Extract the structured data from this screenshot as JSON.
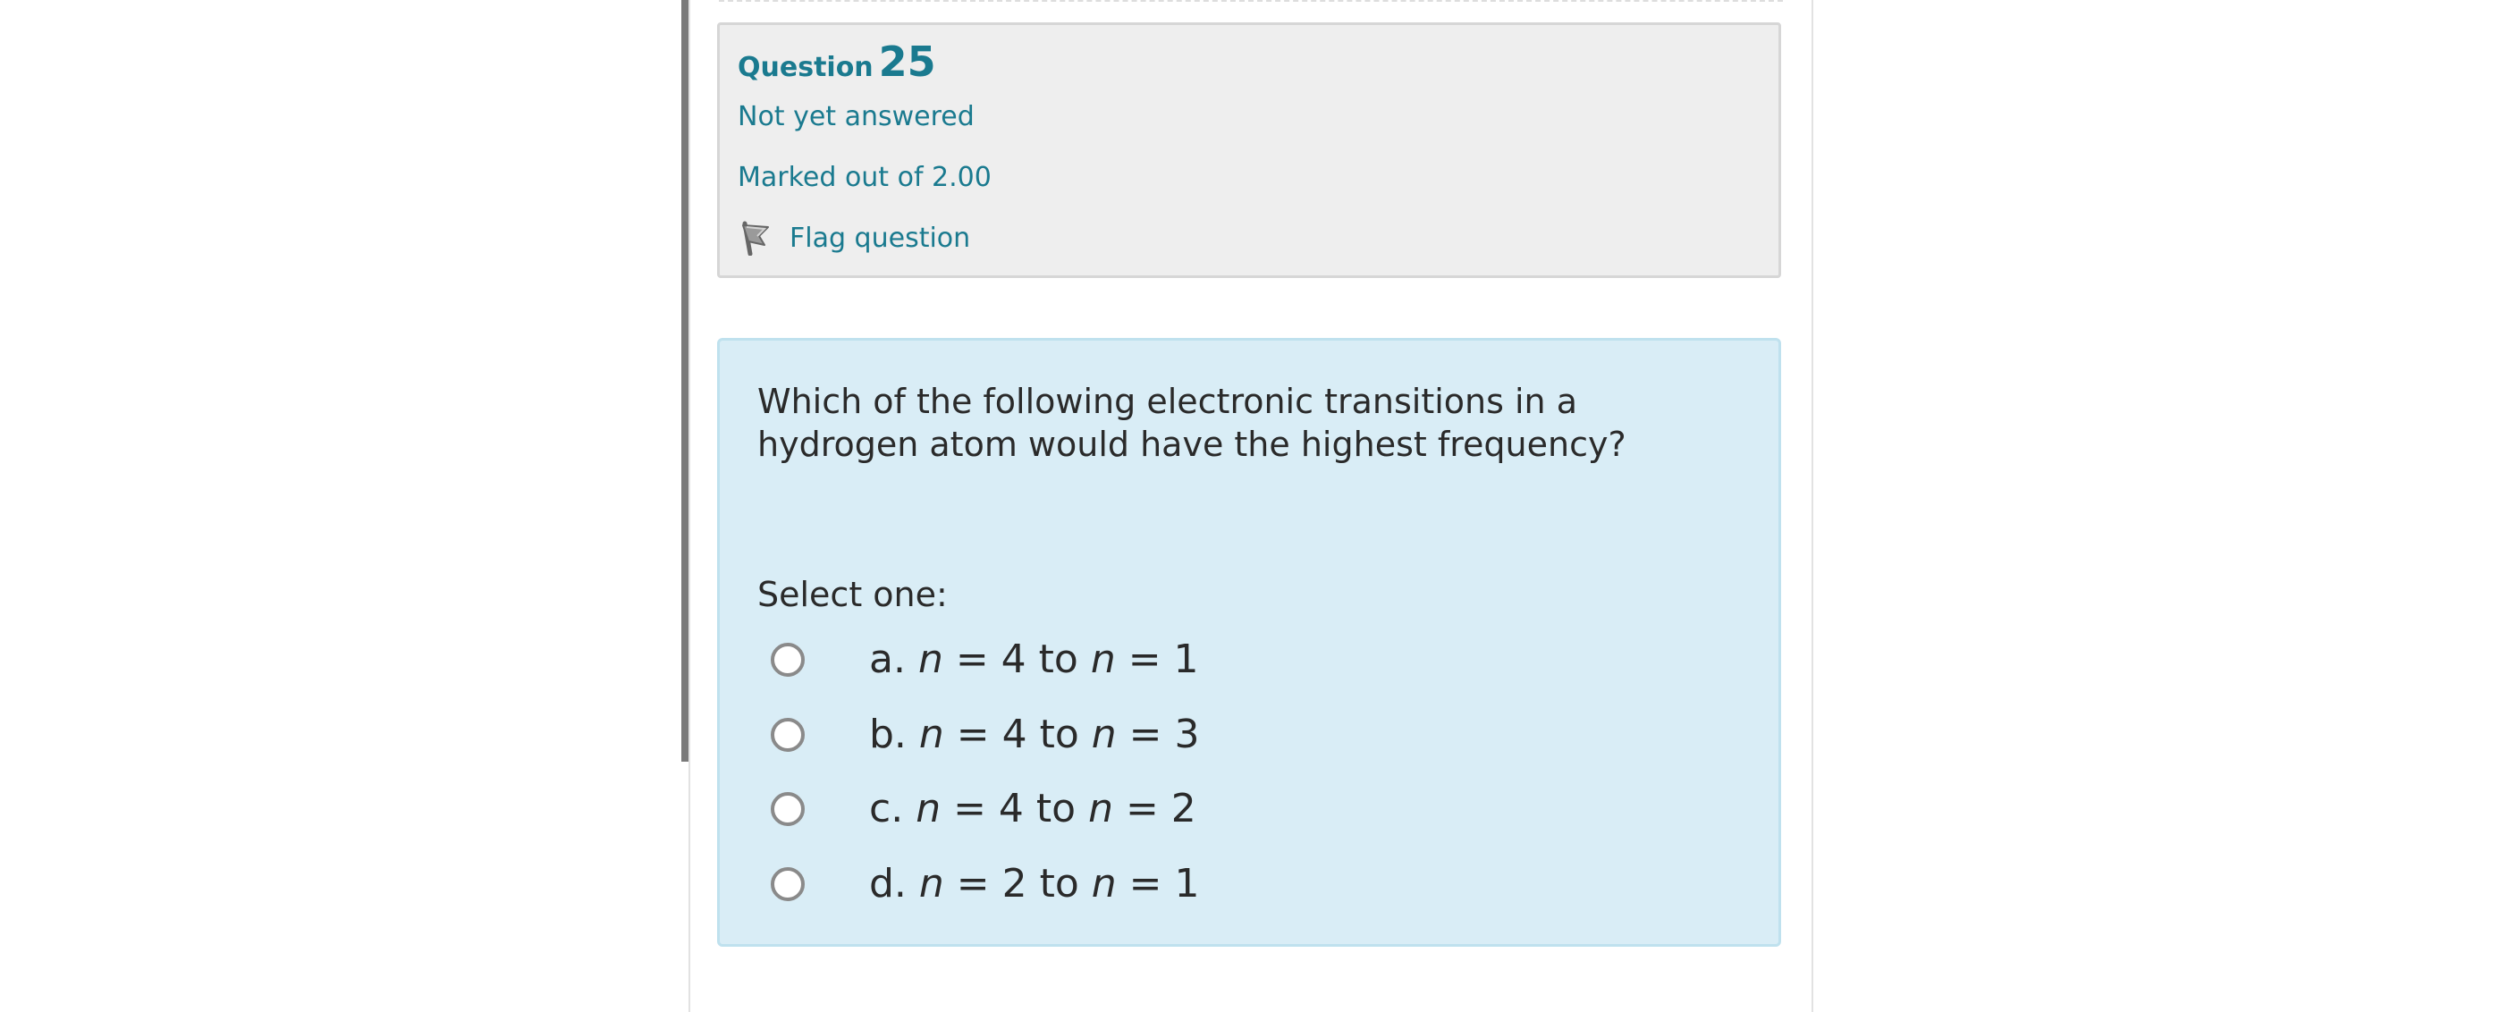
{
  "question": {
    "label": "Question",
    "number": "25",
    "state": "Not yet answered",
    "grade": "Marked out of 2.00",
    "flag_label": "Flag question",
    "flag_icon": "flag-icon",
    "text_line1": "Which of the following electronic transitions in a",
    "text_line2": "hydrogen atom would have the highest frequency?",
    "prompt": "Select one:"
  },
  "answers": [
    {
      "letter": "a.",
      "var1": "n",
      "mid1": " = 4 to ",
      "var2": "n",
      "mid2": " = 1"
    },
    {
      "letter": "b.",
      "var1": "n",
      "mid1": " = 4 to ",
      "var2": "n",
      "mid2": " = 3"
    },
    {
      "letter": "c.",
      "var1": "n",
      "mid1": " = 4 to ",
      "var2": "n",
      "mid2": " = 2"
    },
    {
      "letter": "d.",
      "var1": "n",
      "mid1": " = 2 to ",
      "var2": "n",
      "mid2": " = 1"
    }
  ],
  "colors": {
    "accent": "#1a7a8f",
    "info_bg": "#eeeeee",
    "content_bg": "#d9edf6"
  }
}
